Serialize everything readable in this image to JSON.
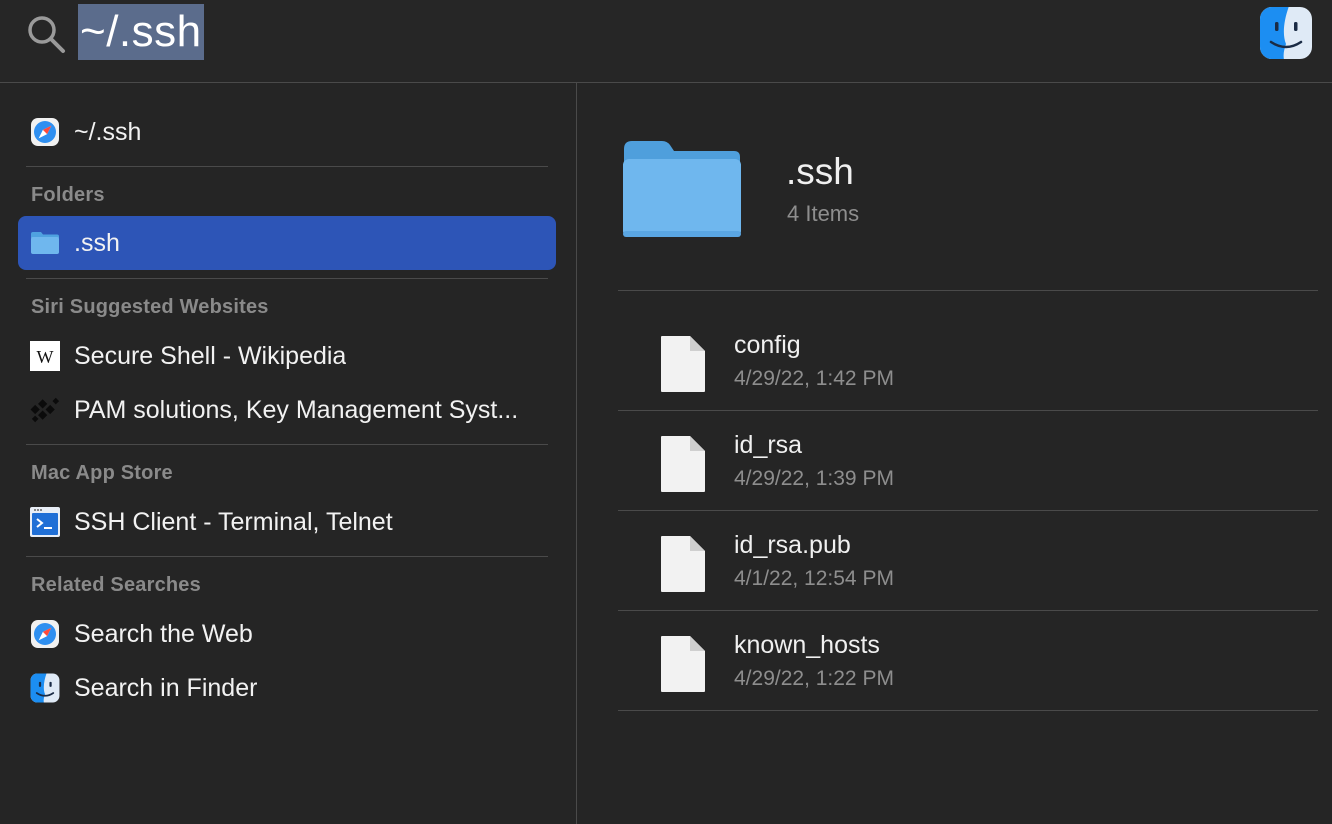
{
  "search": {
    "query": "~/.ssh"
  },
  "results": {
    "top_hit": {
      "label": "~/.ssh",
      "icon": "safari-icon"
    },
    "sections": [
      {
        "header": "Folders",
        "items": [
          {
            "label": ".ssh",
            "icon": "folder-icon",
            "selected": true
          }
        ]
      },
      {
        "header": "Siri Suggested Websites",
        "items": [
          {
            "label": "Secure Shell - Wikipedia",
            "icon": "wikipedia-icon"
          },
          {
            "label": "PAM solutions, Key Management Syst...",
            "icon": "ssh-com-icon"
          }
        ]
      },
      {
        "header": "Mac App Store",
        "items": [
          {
            "label": "SSH Client - Terminal, Telnet",
            "icon": "terminal-app-icon"
          }
        ]
      },
      {
        "header": "Related Searches",
        "items": [
          {
            "label": "Search the Web",
            "icon": "safari-icon"
          },
          {
            "label": "Search in Finder",
            "icon": "finder-icon"
          }
        ]
      }
    ]
  },
  "preview": {
    "title": ".ssh",
    "subtitle": "4 Items",
    "files": [
      {
        "name": "config",
        "date": "4/29/22, 1:42 PM"
      },
      {
        "name": "id_rsa",
        "date": "4/29/22, 1:39 PM"
      },
      {
        "name": "id_rsa.pub",
        "date": "4/1/22, 12:54 PM"
      },
      {
        "name": "known_hosts",
        "date": "4/29/22, 1:22 PM"
      }
    ]
  },
  "colors": {
    "background": "#252525",
    "selection": "#2d55b7",
    "query_highlight": "#5b6c8c",
    "folder_blue": "#6fb7ee"
  }
}
